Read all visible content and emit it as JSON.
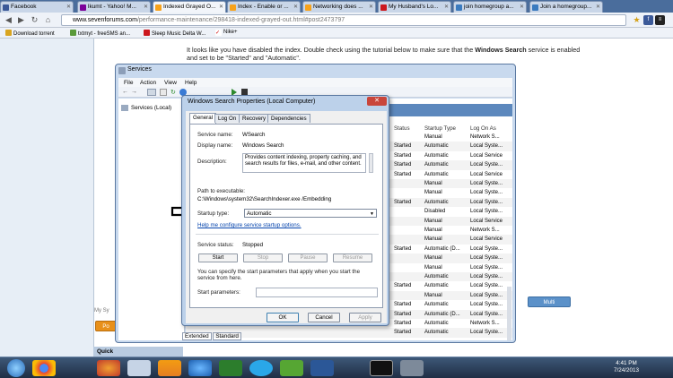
{
  "browser": {
    "tabs": [
      {
        "label": "Facebook",
        "color": "#3b5998"
      },
      {
        "label": "lkumt - Yahoo! M...",
        "color": "#7b0099"
      },
      {
        "label": "Indexed Grayed O...",
        "color": "#f7a21b"
      },
      {
        "label": "Index - Enable or ...",
        "color": "#f7a21b"
      },
      {
        "label": "Networking does ...",
        "color": "#f7a21b"
      },
      {
        "label": "My Husband's Lo...",
        "color": "#cc181e"
      },
      {
        "label": "join homegroup a...",
        "color": "#3b7bbf"
      },
      {
        "label": "Join a homegroup...",
        "color": "#3b7bbf"
      }
    ],
    "active_tab": 2,
    "url_host": "www.sevenforums.com",
    "url_path": "/performance-maintenance/298418-indexed-grayed-out.html#post2473797",
    "bookmarks": [
      "Download torrent",
      "txtmyt - freeSMS an...",
      "Sleep Music Delta W...",
      "Nike+"
    ]
  },
  "page": {
    "post_text_1": "It looks like you have disabled the index. Double check using the tutorial below to make sure that the ",
    "post_text_bold_1": "Windows Search",
    "post_text_2": " service is enabled and set to be \"Started\" and \"Automatic\".",
    "side_label": "My Sy",
    "multi_button": "Multi",
    "quick_label": "Quick",
    "po_label": "Po"
  },
  "services_window": {
    "title": "Services",
    "menu": [
      "File",
      "Action",
      "View",
      "Help"
    ],
    "tree_item": "Services (Local)",
    "columns": {
      "status": "Status",
      "startup": "Startup Type",
      "logon": "Log On As"
    },
    "rows": [
      {
        "status": "",
        "startup": "Manual",
        "logon": "Network S..."
      },
      {
        "status": "Started",
        "startup": "Automatic",
        "logon": "Local Syste..."
      },
      {
        "status": "Started",
        "startup": "Automatic",
        "logon": "Local Service"
      },
      {
        "status": "Started",
        "startup": "Automatic",
        "logon": "Local Syste..."
      },
      {
        "status": "Started",
        "startup": "Automatic",
        "logon": "Local Service"
      },
      {
        "status": "",
        "startup": "Manual",
        "logon": "Local Syste..."
      },
      {
        "status": "",
        "startup": "Manual",
        "logon": "Local Syste..."
      },
      {
        "status": "Started",
        "startup": "Automatic",
        "logon": "Local Syste..."
      },
      {
        "status": "",
        "startup": "Disabled",
        "logon": "Local Syste..."
      },
      {
        "status": "",
        "startup": "Manual",
        "logon": "Local Service"
      },
      {
        "status": "",
        "startup": "Manual",
        "logon": "Network S..."
      },
      {
        "status": "",
        "startup": "Manual",
        "logon": "Local Service"
      },
      {
        "status": "Started",
        "startup": "Automatic (D...",
        "logon": "Local Syste..."
      },
      {
        "status": "",
        "startup": "Manual",
        "logon": "Local Syste..."
      },
      {
        "status": "",
        "startup": "Manual",
        "logon": "Local Syste..."
      },
      {
        "status": "",
        "startup": "Automatic",
        "logon": "Local Syste..."
      },
      {
        "status": "Started",
        "startup": "Automatic",
        "logon": "Local Syste..."
      },
      {
        "status": "",
        "startup": "Manual",
        "logon": "Local Syste..."
      },
      {
        "status": "Started",
        "startup": "Automatic",
        "logon": "Local Syste..."
      },
      {
        "status": "Started",
        "startup": "Automatic (D...",
        "logon": "Local Syste..."
      },
      {
        "status": "Started",
        "startup": "Automatic",
        "logon": "Network S..."
      },
      {
        "status": "Started",
        "startup": "Automatic",
        "logon": "Local Syste..."
      }
    ],
    "bottom_tabs": [
      "Extended",
      "Standard"
    ]
  },
  "dialog": {
    "title": "Windows Search Properties (Local Computer)",
    "tabs": [
      "General",
      "Log On",
      "Recovery",
      "Dependencies"
    ],
    "service_name_label": "Service name:",
    "service_name": "WSearch",
    "display_name_label": "Display name:",
    "display_name": "Windows Search",
    "description_label": "Description:",
    "description": "Provides content indexing, property caching, and search results for files, e-mail, and other content.",
    "path_label": "Path to executable:",
    "path": "C:\\Windows\\system32\\SearchIndexer.exe /Embedding",
    "startup_label": "Startup type:",
    "startup_value": "Automatic",
    "help_link": "Help me configure service startup options.",
    "status_label": "Service status:",
    "status_value": "Stopped",
    "buttons": {
      "start": "Start",
      "stop": "Stop",
      "pause": "Pause",
      "resume": "Resume"
    },
    "note": "You can specify the start parameters that apply when you start the service from here.",
    "params_label": "Start parameters:",
    "ok": "OK",
    "cancel": "Cancel",
    "apply": "Apply"
  },
  "taskbar": {
    "time": "4:41 PM",
    "date": "7/24/2013",
    "icons": [
      "start-orb-icon",
      "chrome-icon",
      "firefox-icon",
      "network-icon",
      "vlc-icon",
      "ie-icon",
      "camera-icon",
      "skype-icon",
      "utorrent-icon",
      "word-icon",
      "cmd-icon",
      "settings-icon"
    ]
  }
}
